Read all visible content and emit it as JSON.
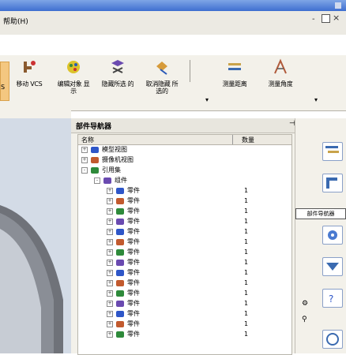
{
  "menu": {
    "help_label": "帮助(H)",
    "win_min": "-",
    "win_close": "×"
  },
  "toolbar": {
    "left_label": "S",
    "buttons": [
      {
        "label": "移动 VCS",
        "icon": "move-vcs-icon",
        "color": "#8a5a2e"
      },
      {
        "label": "编辑对象 显示",
        "icon": "edit-display-icon",
        "color": "#5a8a2e"
      },
      {
        "label": "隐藏所选 的",
        "icon": "hide-selected-icon",
        "color": "#6a4ab0"
      },
      {
        "label": "取消隐藏 所选的",
        "icon": "unhide-selected-icon",
        "color": "#8a6a2e"
      },
      {
        "label": "测量距离",
        "icon": "measure-distance-icon",
        "color": "#3a6ab0"
      },
      {
        "label": "测量角度",
        "icon": "measure-angle-icon",
        "color": "#b05a3a"
      }
    ]
  },
  "panel": {
    "title": "部件导航器",
    "columns": {
      "name": "名称",
      "qty": "数量"
    },
    "rows": [
      {
        "label": "模型视图",
        "indent": 0,
        "exp": "+"
      },
      {
        "label": "摄像机视图",
        "indent": 0,
        "exp": "+"
      },
      {
        "label": "引用集",
        "indent": 0,
        "exp": "-"
      },
      {
        "label": "组件",
        "indent": 1,
        "exp": "-"
      },
      {
        "label": "零件",
        "indent": 2,
        "exp": "+",
        "qty": "1"
      },
      {
        "label": "零件",
        "indent": 2,
        "exp": "+",
        "qty": "1"
      },
      {
        "label": "零件",
        "indent": 2,
        "exp": "+",
        "qty": "1"
      },
      {
        "label": "零件",
        "indent": 2,
        "exp": "+",
        "qty": "1"
      },
      {
        "label": "零件",
        "indent": 2,
        "exp": "+",
        "qty": "1"
      },
      {
        "label": "零件",
        "indent": 2,
        "exp": "+",
        "qty": "1"
      },
      {
        "label": "零件",
        "indent": 2,
        "exp": "+",
        "qty": "1"
      },
      {
        "label": "零件",
        "indent": 2,
        "exp": "+",
        "qty": "1"
      },
      {
        "label": "零件",
        "indent": 2,
        "exp": "+",
        "qty": "1"
      },
      {
        "label": "零件",
        "indent": 2,
        "exp": "+",
        "qty": "1"
      },
      {
        "label": "零件",
        "indent": 2,
        "exp": "+",
        "qty": "1"
      },
      {
        "label": "零件",
        "indent": 2,
        "exp": "+",
        "qty": "1"
      },
      {
        "label": "零件",
        "indent": 2,
        "exp": "+",
        "qty": "1"
      },
      {
        "label": "零件",
        "indent": 2,
        "exp": "+",
        "qty": "1"
      },
      {
        "label": "零件",
        "indent": 2,
        "exp": "+",
        "qty": "1"
      }
    ]
  },
  "rightcol": {
    "tab_label": "部件导航器"
  },
  "colors": {
    "accent": "#2e56c8",
    "panel_bg": "#f3f1ea",
    "viewport_bg": "#d5dde8"
  }
}
